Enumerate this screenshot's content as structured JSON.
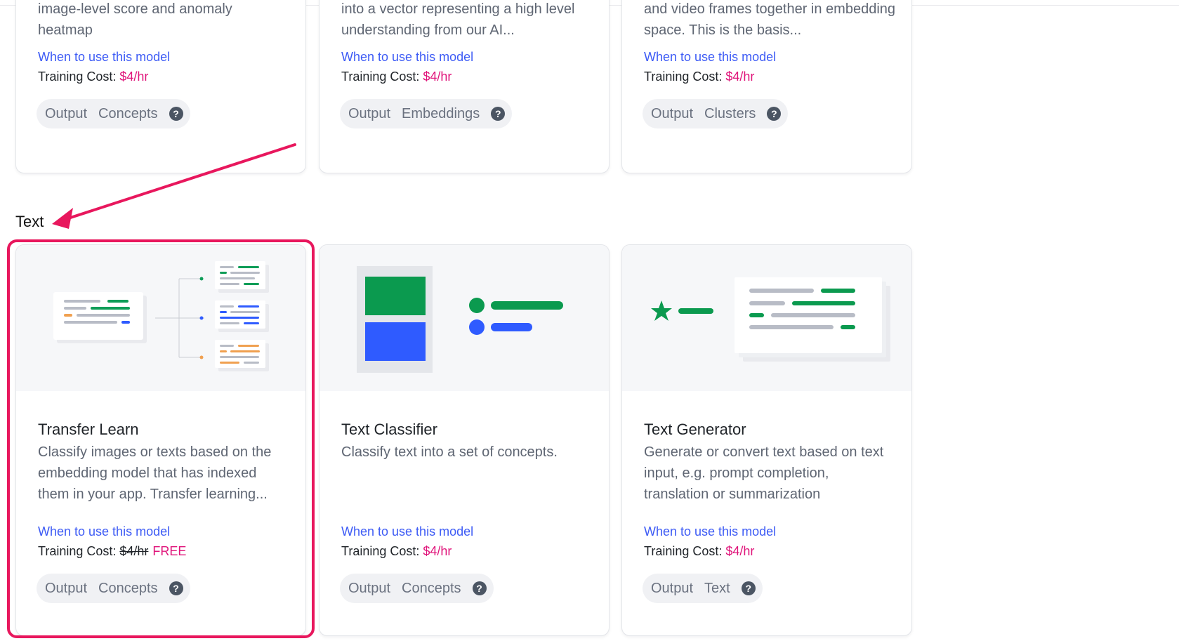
{
  "colors": {
    "link": "#3d5bf5",
    "price": "#e0147a",
    "highlight": "#e8175d",
    "green": "#0f9d58",
    "blue": "#2f5bff",
    "orange": "#f0a050"
  },
  "top_cards": [
    {
      "desc": "image-level score and anomaly heatmap",
      "link": "When to use this model",
      "cost_label": "Training Cost: ",
      "price": "$4/hr",
      "output_label": "Output",
      "output_value": "Concepts"
    },
    {
      "desc": "into a vector representing a high level understanding from our AI...",
      "link": "When to use this model",
      "cost_label": "Training Cost: ",
      "price": "$4/hr",
      "output_label": "Output",
      "output_value": "Embeddings"
    },
    {
      "desc": "and video frames together in embedding space. This is the basis...",
      "link": "When to use this model",
      "cost_label": "Training Cost: ",
      "price": "$4/hr",
      "output_label": "Output",
      "output_value": "Clusters"
    }
  ],
  "section": {
    "title": "Text"
  },
  "text_cards": [
    {
      "title": "Transfer Learn",
      "desc": "Classify images or texts based on the embedding model that has indexed them in your app. Transfer learning...",
      "link": "When to use this model",
      "cost_label": "Training Cost: ",
      "old_price": "$4/hr",
      "price": "FREE",
      "output_label": "Output",
      "output_value": "Concepts"
    },
    {
      "title": "Text Classifier",
      "desc": "Classify text into a set of concepts.",
      "link": "When to use this model",
      "cost_label": "Training Cost: ",
      "price": "$4/hr",
      "output_label": "Output",
      "output_value": "Concepts"
    },
    {
      "title": "Text Generator",
      "desc": "Generate or convert text based on text input, e.g. prompt completion, translation or summarization",
      "link": "When to use this model",
      "cost_label": "Training Cost: ",
      "price": "$4/hr",
      "output_label": "Output",
      "output_value": "Text"
    }
  ],
  "help_icon": "?"
}
